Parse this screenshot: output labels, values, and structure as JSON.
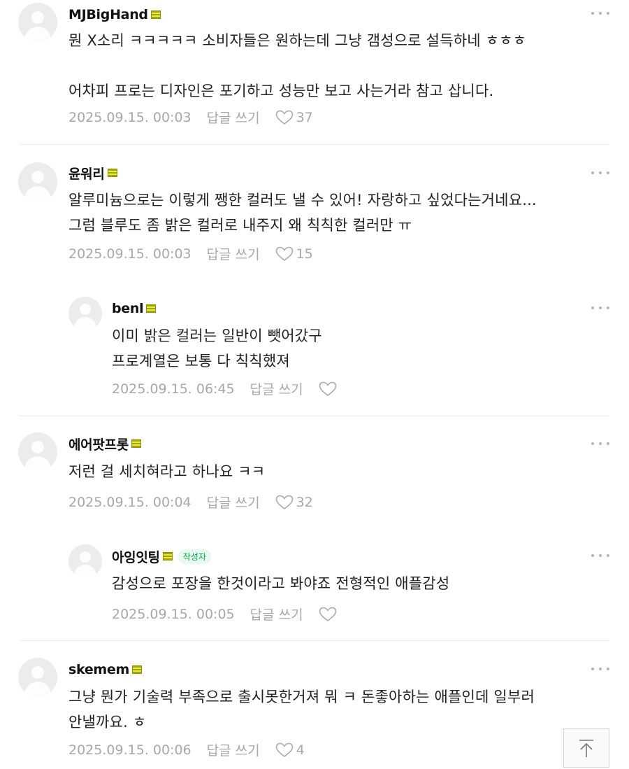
{
  "comments": [
    {
      "nick": "MJBigHand",
      "lines": [
        "뭔 X소리 ㅋㅋㅋㅋㅋ 소비자들은 원하는데 그냥 갬성으로 설득하네 ㅎㅎㅎ",
        "",
        "어차피 프로는 디자인은 포기하고 성능만 보고 사는거라 참고 삽니다."
      ],
      "date": "2025.09.15. 00:03",
      "reply_label": "답글 쓰기",
      "likes": "37"
    },
    {
      "nick": "윤워리",
      "lines": [
        "알루미늄으로는 이렇게 쨍한 컬러도 낼 수 있어! 자랑하고 싶었다는거네요...",
        "그럼 블루도 좀 밝은 컬러로 내주지 왜 칙칙한 컬러만 ㅠ"
      ],
      "date": "2025.09.15. 00:03",
      "reply_label": "답글 쓰기",
      "likes": "15"
    },
    {
      "nick": "benl",
      "lines": [
        "이미 밝은 컬러는 일반이 뺏어갔구",
        "프로계열은 보통 다 칙칙했져"
      ],
      "date": "2025.09.15. 06:45",
      "reply_label": "답글 쓰기",
      "likes": ""
    },
    {
      "nick": "에어팟프롯",
      "lines": [
        "저런 걸 세치혀라고 하나요 ㅋㅋ"
      ],
      "date": "2025.09.15. 00:04",
      "reply_label": "답글 쓰기",
      "likes": "32"
    },
    {
      "nick": "아잉잇팅",
      "badge": "작성자",
      "lines": [
        "감성으로 포장을 한것이라고 봐야죠 전형적인 애플감성"
      ],
      "date": "2025.09.15. 00:05",
      "reply_label": "답글 쓰기",
      "likes": ""
    },
    {
      "nick": "skemem",
      "lines": [
        "그냥 뭔가 기술력 부족으로 출시못한거져 뭐 ㅋ 돈좋아하는 애플인데 일부러",
        "안낼까요. ㅎ"
      ],
      "date": "2025.09.15. 00:06",
      "reply_label": "답글 쓰기",
      "likes": "4"
    }
  ],
  "icons": {
    "grade": "grade-icon",
    "more": "more-dots-icon",
    "like": "heart-icon",
    "top": "scroll-top-icon"
  },
  "colors": {
    "author_badge": "#03a94d",
    "meta_text": "#a8a8a8"
  }
}
